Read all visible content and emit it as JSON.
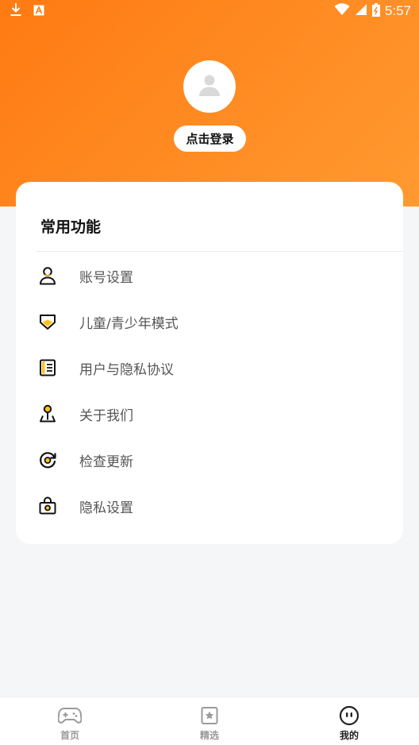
{
  "status_bar": {
    "time": "5:57",
    "icons": [
      "download-icon",
      "app-a-icon",
      "wifi-icon",
      "signal-icon",
      "battery-icon"
    ]
  },
  "profile": {
    "avatar_icon": "user-placeholder-icon",
    "login_label": "点击登录"
  },
  "section": {
    "title": "常用功能",
    "items": [
      {
        "label": "账号设置",
        "icon": "user-icon"
      },
      {
        "label": "儿童/青少年模式",
        "icon": "shield-icon"
      },
      {
        "label": "用户与隐私协议",
        "icon": "document-icon"
      },
      {
        "label": "关于我们",
        "icon": "person-pin-icon"
      },
      {
        "label": "检查更新",
        "icon": "refresh-icon"
      },
      {
        "label": "隐私设置",
        "icon": "lock-bag-icon"
      }
    ]
  },
  "tabbar": {
    "tabs": [
      {
        "label": "首页",
        "icon": "gamepad-icon",
        "active": false
      },
      {
        "label": "精选",
        "icon": "star-card-icon",
        "active": false
      },
      {
        "label": "我的",
        "icon": "face-icon",
        "active": true
      }
    ]
  },
  "colors": {
    "accent": "#ff7a12",
    "accent_secondary": "#ffc21a",
    "background": "#f5f6f8"
  }
}
